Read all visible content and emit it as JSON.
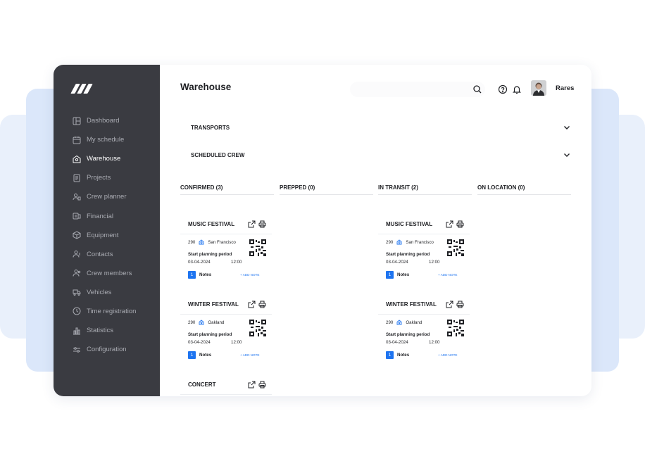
{
  "sidebar": {
    "items": [
      {
        "label": "Dashboard",
        "icon": "dashboard-icon",
        "active": false
      },
      {
        "label": "My schedule",
        "icon": "calendar-icon",
        "active": false
      },
      {
        "label": "Warehouse",
        "icon": "warehouse-icon",
        "active": true
      },
      {
        "label": "Projects",
        "icon": "document-icon",
        "active": false
      },
      {
        "label": "Crew planner",
        "icon": "crew-planner-icon",
        "active": false
      },
      {
        "label": "Financial",
        "icon": "money-icon",
        "active": false
      },
      {
        "label": "Equipment",
        "icon": "box-icon",
        "active": false
      },
      {
        "label": "Contacts",
        "icon": "contacts-icon",
        "active": false
      },
      {
        "label": "Crew members",
        "icon": "crew-members-icon",
        "active": false
      },
      {
        "label": "Vehicles",
        "icon": "truck-icon",
        "active": false
      },
      {
        "label": "Time registration",
        "icon": "clock-icon",
        "active": false
      },
      {
        "label": "Statistics",
        "icon": "statistics-icon",
        "active": false
      },
      {
        "label": "Configuration",
        "icon": "sliders-icon",
        "active": false
      }
    ]
  },
  "header": {
    "title": "Warehouse",
    "user_name": "Rares"
  },
  "sections": {
    "transports": "TRANSPORTS",
    "scheduled_crew": "SCHEDULED CREW"
  },
  "columns": {
    "confirmed": "CONFIRMED (3)",
    "prepped": "PREPPED (0)",
    "in_transit": "IN TRANSIT (2)",
    "on_location": "ON LOCATION (0)"
  },
  "cards": {
    "c1": {
      "name": "MUSIC FESTIVAL",
      "number": "290",
      "location": "San Francisco",
      "planning_label": "Start planning period",
      "date": "03-04-2024",
      "time": "12:00",
      "notes_count": "1",
      "notes_label": "Notes",
      "add_note": "+ ADD NOTE"
    },
    "c2": {
      "name": "WINTER FESTIVAL",
      "number": "290",
      "location": "Oakland",
      "planning_label": "Start planning period",
      "date": "03-04-2024",
      "time": "12:00",
      "notes_count": "1",
      "notes_label": "Notes",
      "add_note": "+ ADD NOTE"
    },
    "c3": {
      "name": "CONCERT"
    },
    "t1": {
      "name": "MUSIC FESTIVAL",
      "number": "290",
      "location": "San Francisco",
      "planning_label": "Start planning period",
      "date": "03-04-2024",
      "time": "12:00",
      "notes_count": "1",
      "notes_label": "Notes",
      "add_note": "+ ADD NOTE"
    },
    "t2": {
      "name": "WINTER FESTIVAL",
      "number": "290",
      "location": "Oakland",
      "planning_label": "Start planning period",
      "date": "03-04-2024",
      "time": "12:00",
      "notes_count": "1",
      "notes_label": "Notes",
      "add_note": "+ ADD NOTE"
    }
  },
  "colors": {
    "sidebar_bg": "#3a3b41",
    "accent": "#1e74f0",
    "backdrop": "#dbe7fa"
  }
}
